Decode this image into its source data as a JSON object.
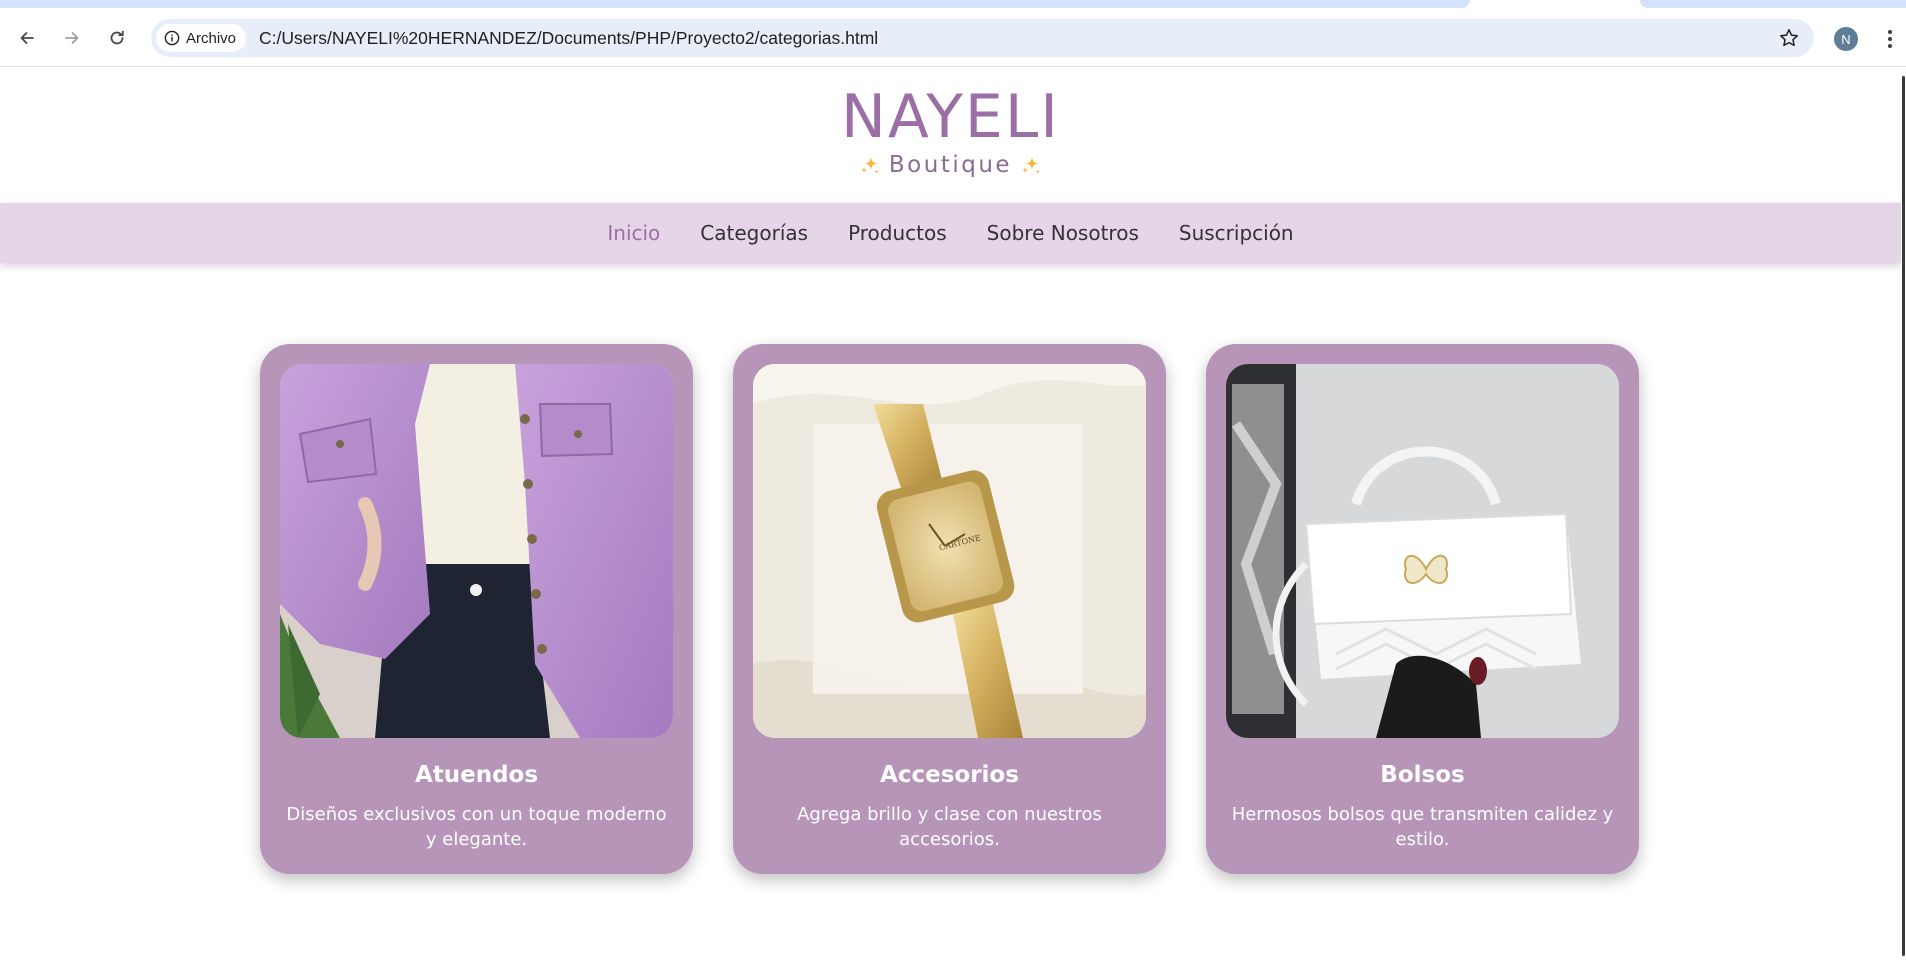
{
  "browser": {
    "site_chip_label": "Archivo",
    "url": "C:/Users/NAYELI%20HERNANDEZ/Documents/PHP/Proyecto2/categorias.html",
    "profile_initial": "N",
    "icons": [
      "back-arrow-icon",
      "forward-arrow-icon",
      "reload-icon",
      "info-icon",
      "bookmark-star-icon",
      "more-vert-icon"
    ]
  },
  "header": {
    "brand": "NAYELI",
    "tagline": "Boutique"
  },
  "nav": {
    "items": [
      {
        "label": "Inicio",
        "active": true
      },
      {
        "label": "Categorías",
        "active": false
      },
      {
        "label": "Productos",
        "active": false
      },
      {
        "label": "Sobre Nosotros",
        "active": false
      },
      {
        "label": "Suscripción",
        "active": false
      }
    ]
  },
  "categories": [
    {
      "title": "Atuendos",
      "description": "Diseños exclusivos con un toque moderno y elegante.",
      "image": "purple-denim-jacket-photo"
    },
    {
      "title": "Accesorios",
      "description": "Agrega brillo y clase con nuestros accesorios.",
      "image": "gold-watch-photo"
    },
    {
      "title": "Bolsos",
      "description": "Hermosos bolsos que transmiten calidez y estilo.",
      "image": "white-handbag-photo"
    }
  ],
  "colors": {
    "brand": "#9b6fa6",
    "nav_background": "#e6d4e8",
    "card_background": "#b695b9"
  }
}
